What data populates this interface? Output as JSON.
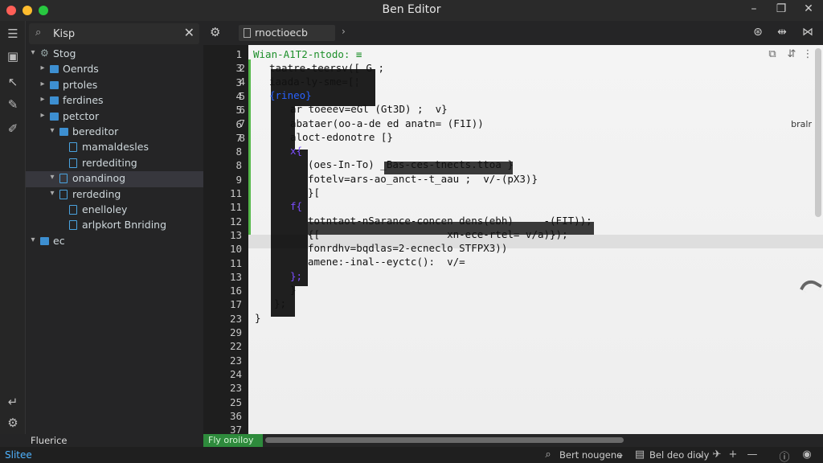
{
  "window": {
    "title": "Ben Editor"
  },
  "sidebar": {
    "search_value": "Kisp",
    "tree": [
      {
        "label": "Stog",
        "kind": "gear",
        "indent": 0,
        "arrow": "▾"
      },
      {
        "label": "Oenrds",
        "kind": "folder",
        "indent": 1,
        "arrow": "▸"
      },
      {
        "label": "prtoles",
        "kind": "folder",
        "indent": 1,
        "arrow": "▸"
      },
      {
        "label": "ferdines",
        "kind": "folder",
        "indent": 1,
        "arrow": "▸"
      },
      {
        "label": "petctor",
        "kind": "folder",
        "indent": 1,
        "arrow": "▸"
      },
      {
        "label": "bereditor",
        "kind": "folder",
        "indent": 2,
        "arrow": "▾"
      },
      {
        "label": "mamaldesles",
        "kind": "file",
        "indent": 3,
        "arrow": ""
      },
      {
        "label": "rerdediting",
        "kind": "file",
        "indent": 3,
        "arrow": ""
      },
      {
        "label": "onandinog",
        "kind": "file",
        "indent": 2,
        "arrow": "▾",
        "selected": true
      },
      {
        "label": "rerdeding",
        "kind": "file",
        "indent": 2,
        "arrow": "▾"
      },
      {
        "label": "enelloley",
        "kind": "file",
        "indent": 3,
        "arrow": ""
      },
      {
        "label": "arlpkort Bnriding",
        "kind": "file",
        "indent": 3,
        "arrow": ""
      },
      {
        "label": "ec",
        "kind": "folder",
        "indent": 0,
        "arrow": "▾"
      }
    ]
  },
  "tabs": {
    "active_label": "rnoctioecb"
  },
  "editor": {
    "line_numbers": [
      "1",
      "3",
      "3",
      "4",
      "5",
      "6",
      "7",
      "8",
      "8",
      "9",
      "11",
      "11",
      "12",
      "13",
      "10",
      "11",
      "13",
      "16",
      "17",
      "23",
      "29",
      "22",
      "23",
      "24",
      "23",
      "25",
      "36",
      "37"
    ],
    "line_numbers_b": [
      "2",
      "4",
      "5",
      "6",
      "7",
      "8"
    ],
    "lines": [
      {
        "text": "Wian-A1T2-ntodo: ≡",
        "cls": "green"
      },
      {
        "text": "taatre-teersv([ G ;",
        "cls": ""
      },
      {
        "text": "iaada-ly-sme=[¦",
        "cls": ""
      },
      {
        "text": "{rineo}",
        "cls": "blue"
      },
      {
        "text": "ar toeeev=eGl (Gt3D) ;  v}",
        "cls": ""
      },
      {
        "text": "abataer(oo-a-de ed anatn= (F1I))",
        "cls": ""
      },
      {
        "text": "aloct-edonotre [}",
        "cls": ""
      },
      {
        "text": "x{ ",
        "cls": "purple"
      },
      {
        "text": "(oes-In-To) _Bas-ces-tnects.ttoa }",
        "cls": ""
      },
      {
        "text": "fotelv=ars-ao_anct--t_aau ;  v/-(pX3)}",
        "cls": ""
      },
      {
        "text": "}[",
        "cls": ""
      },
      {
        "text": "f{",
        "cls": "purple"
      },
      {
        "text": "totntaot-nSarance-concen dens(ebh)     -(FIT));",
        "cls": ""
      },
      {
        "text": "{[                     xn-ece-rtel= v/a)});",
        "cls": ""
      },
      {
        "text": "fonrdhv=bqdlas=2-ecneclo STFPX3))",
        "cls": ""
      },
      {
        "text": "amene:-inal--eyctc():  v/=",
        "cls": ""
      },
      {
        "text": "};",
        "cls": "purple"
      },
      {
        "text": "}",
        "cls": ""
      },
      {
        "text": "};",
        "cls": ""
      },
      {
        "text": "}",
        "cls": ""
      }
    ],
    "minimap_label": "bralr"
  },
  "bottom": {
    "left_label": "Fluerice",
    "green_tab": "Fly oroiloy"
  },
  "status": {
    "left": "Slitee",
    "items": [
      "Bert nougene",
      "Bel deo dioly"
    ]
  },
  "colors": {
    "accent_green": "#55b84a",
    "status_blue": "#4fb3ff",
    "folder_blue": "#3d8fd1"
  }
}
